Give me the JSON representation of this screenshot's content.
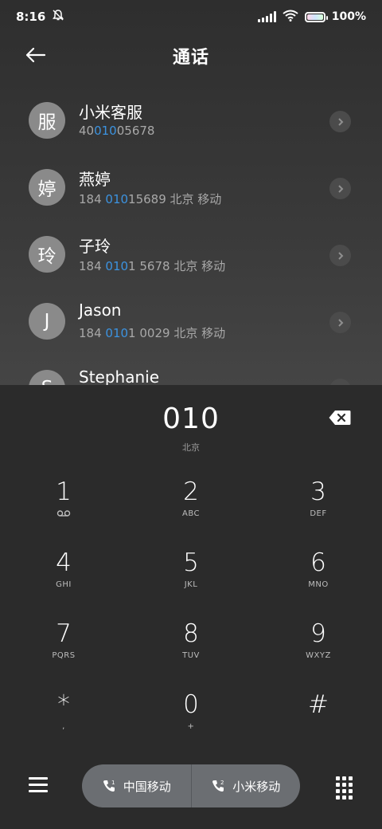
{
  "status_bar": {
    "time": "8:16",
    "battery": "100%",
    "icons": [
      "bell-off-icon",
      "signal-icon",
      "wifi-icon",
      "battery-icon"
    ]
  },
  "header": {
    "title": "通话",
    "back_icon": "arrow-left-icon"
  },
  "contacts": [
    {
      "avatar": "服",
      "name": "小米客服",
      "num_pre": "40",
      "num_hl": "010",
      "num_post": "05678",
      "location": ""
    },
    {
      "avatar": "婷",
      "name": "燕婷",
      "num_pre": "184 ",
      "num_hl": "010",
      "num_post": "15689",
      "location": "  北京 移动"
    },
    {
      "avatar": "玲",
      "name": "子玲",
      "num_pre": "184 ",
      "num_hl": "010",
      "num_post": "1 5678",
      "location": "  北京 移动"
    },
    {
      "avatar": "J",
      "name": "Jason",
      "num_pre": "184 ",
      "num_hl": "010",
      "num_post": "1 0029",
      "location": "  北京 移动"
    },
    {
      "avatar": "S",
      "name": "Stephanie",
      "num_pre": "",
      "num_hl": "",
      "num_post": "",
      "location": ""
    }
  ],
  "dialpad": {
    "entered": "010",
    "region": "北京",
    "keys": [
      {
        "digit": "1",
        "letters": ""
      },
      {
        "digit": "2",
        "letters": "ABC"
      },
      {
        "digit": "3",
        "letters": "DEF"
      },
      {
        "digit": "4",
        "letters": "GHI"
      },
      {
        "digit": "5",
        "letters": "JKL"
      },
      {
        "digit": "6",
        "letters": "MNO"
      },
      {
        "digit": "7",
        "letters": "PQRS"
      },
      {
        "digit": "8",
        "letters": "TUV"
      },
      {
        "digit": "9",
        "letters": "WXYZ"
      },
      {
        "digit": "*",
        "letters": ","
      },
      {
        "digit": "0",
        "letters": "+"
      },
      {
        "digit": "#",
        "letters": ""
      }
    ]
  },
  "bottom": {
    "sim1_label": "中国移动",
    "sim2_label": "小米移动"
  },
  "colors": {
    "highlight": "#3c93e0",
    "avatar": "#8a8a8a",
    "call_pill": "#6b6e72"
  }
}
